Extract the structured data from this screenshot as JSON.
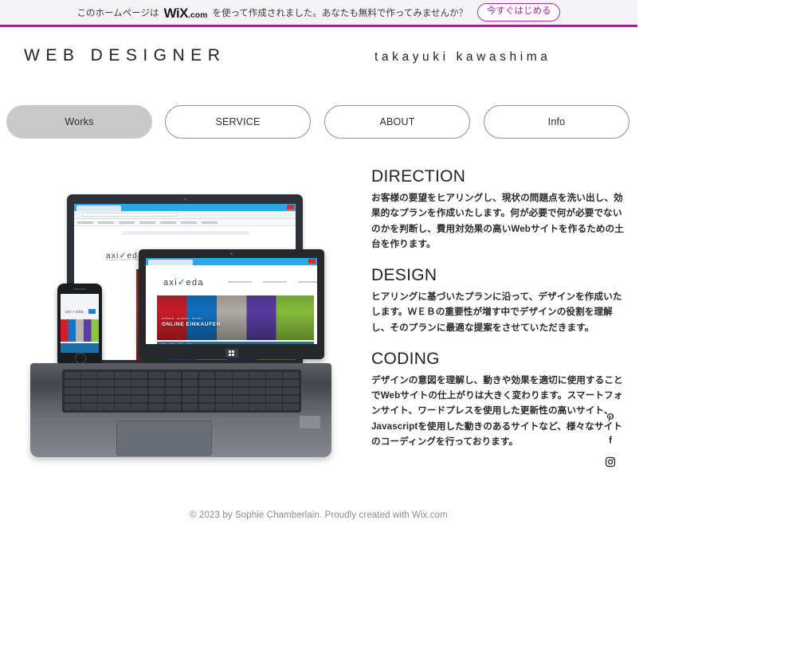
{
  "promo_banner": {
    "text_before_logo": "このホームページは",
    "logo_text": "WiX",
    "logo_suffix": ".com",
    "text_after_logo": "を使って作成されました。あなたも無料で作ってみませんか？",
    "cta_label": "今すぐはじめる",
    "accent_color": "#a8219b",
    "background_color": "#f4f4f6"
  },
  "header": {
    "title": "WEB DESIGNER",
    "name": "takayuki kawashima"
  },
  "nav": {
    "tabs": [
      {
        "label": "Works",
        "active": true
      },
      {
        "label": "SERVICE",
        "active": false
      },
      {
        "label": "ABOUT",
        "active": false
      },
      {
        "label": "Info",
        "active": false
      }
    ],
    "active_background": "#c9c9c9",
    "inactive_border": "#8f8f8f"
  },
  "photo": {
    "alt_name": "devices-showcase-photo",
    "site_logo": "axi",
    "site_logo_check": "✓",
    "site_logo_end": "eda",
    "site_tagline": "creative lifestyle shopping",
    "hero_caption_small": "einfach. schnell. sicher.",
    "hero_caption": "ONLINE EINKAUFEN"
  },
  "sections": [
    {
      "title": "DIRECTION",
      "body": "お客様の要望をヒアリングし、現状の問題点を洗い出し、効果的なプランを作成いたします。何が必要で何が必要でないのかを判断し、費用対効果の高いWebサイトを作るための土台を作ります。"
    },
    {
      "title": "DESIGN",
      "body": "ヒアリングに基づいたプランに沿って、デザインを作成いたします。ＷＥＢの重要性が増す中でデザインの役割を理解し、そのプランに最適な提案をさせていただきます。"
    },
    {
      "title": "CODING",
      "body": "デザインの意図を理解し、動きや効果を適切に使用することでWebサイトの仕上がりは大きく変わります。スマートフォンサイト、ワードプレスを使用した更新性の高いサイト、Javascriptを使用した動きのあるサイトなど、様々なサイトのコーディングを行っております。"
    }
  ],
  "social": [
    {
      "icon": "pinterest-icon",
      "glyph": "𝓅"
    },
    {
      "icon": "facebook-icon",
      "glyph": "f"
    },
    {
      "icon": "instagram-icon",
      "glyph": ""
    }
  ],
  "footer": {
    "text": "© 2023 by Sophie Chamberlain. Proudly created with Wix.com"
  }
}
